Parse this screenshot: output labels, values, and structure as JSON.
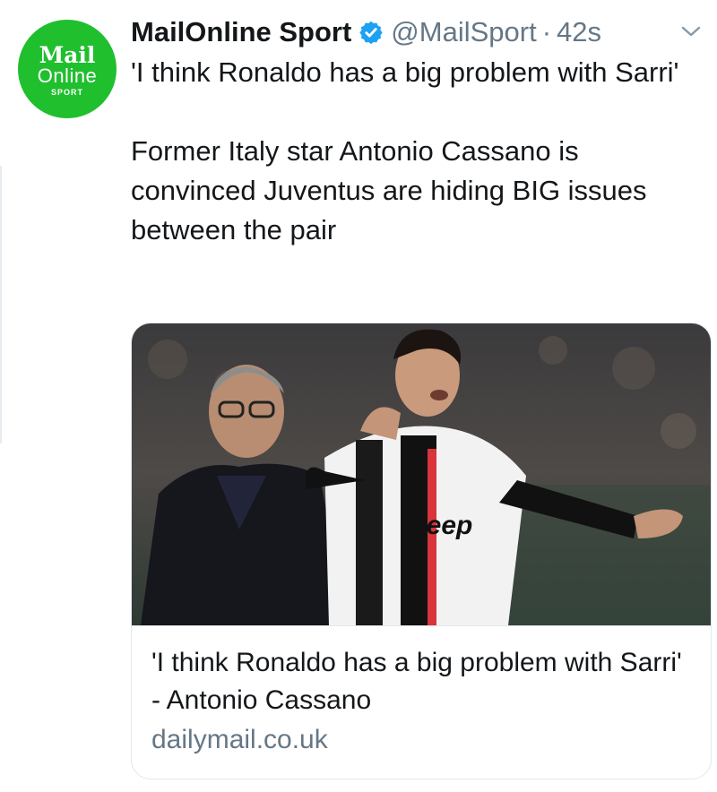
{
  "tweet": {
    "avatar": {
      "line1": "Mail",
      "line2": "Online",
      "line3": "SPORT",
      "color": "#1fbf2d"
    },
    "author_name": "MailOnline Sport",
    "verified_icon": "verified-badge-icon",
    "handle": "@MailSport",
    "separator": "·",
    "time": "42s",
    "menu_icon": "chevron-down-icon",
    "text_line1": "'I think Ronaldo has a big problem with Sarri'",
    "text_line2": "Former Italy star Antonio Cassano is convinced Juventus are hiding BIG issues between the pair"
  },
  "card": {
    "image_alt": "Maurizio Sarri and Cristiano Ronaldo on the touchline",
    "shirt_text": "Jeep",
    "title": "'I think Ronaldo has a big problem with Sarri' - Antonio Cassano",
    "domain": "dailymail.co.uk"
  },
  "colors": {
    "text": "#14171a",
    "secondary": "#657786",
    "verified": "#1da1f2",
    "border": "#e1e8ed"
  }
}
